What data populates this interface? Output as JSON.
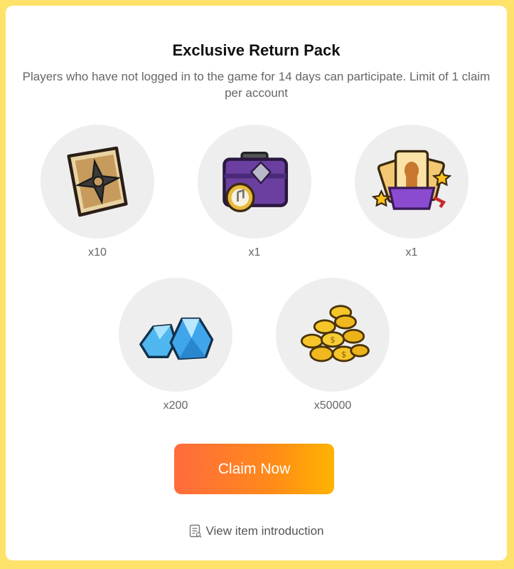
{
  "pack": {
    "title": "Exclusive Return Pack",
    "description": "Players who have not logged in to the game for 14 days can participate. Limit of 1 claim per account"
  },
  "rewards": [
    {
      "icon": "shuriken-scroll-icon",
      "quantity": "x10"
    },
    {
      "icon": "purple-chest-icon",
      "quantity": "x1"
    },
    {
      "icon": "card-pack-icon",
      "quantity": "x1"
    },
    {
      "icon": "blue-gems-icon",
      "quantity": "x200"
    },
    {
      "icon": "gold-coins-icon",
      "quantity": "x50000"
    }
  ],
  "claim_button": {
    "label": "Claim Now"
  },
  "intro_link": {
    "label": "View item introduction",
    "icon": "document-list-icon"
  },
  "colors": {
    "frame": "#FFE26A",
    "button_start": "#FF6B3D",
    "button_end": "#FFB300"
  }
}
